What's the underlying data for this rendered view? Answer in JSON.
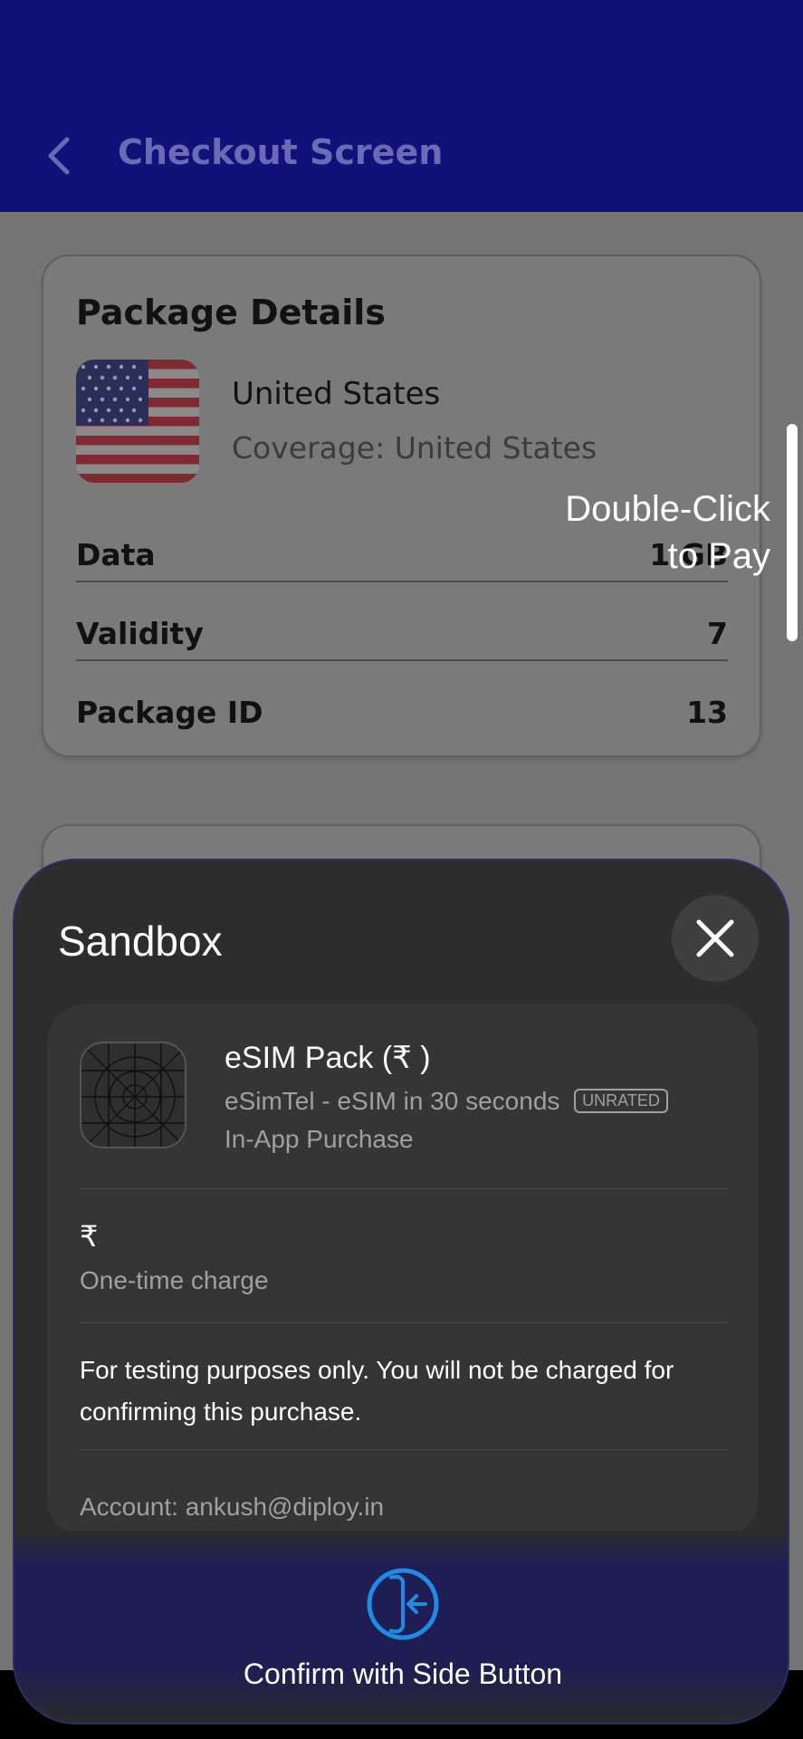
{
  "header": {
    "title": "Checkout Screen",
    "back_icon": "chevron-left-icon"
  },
  "package_details": {
    "title": "Package Details",
    "country": "United States",
    "coverage": "Coverage: United States",
    "flag_icon": "us-flag-icon",
    "rows": [
      {
        "label": "Data",
        "value": "1 GB"
      },
      {
        "label": "Validity",
        "value": "7"
      },
      {
        "label": "Package ID",
        "value": "13"
      }
    ]
  },
  "overlay_hint": {
    "line1": "Double-Click",
    "line2": "to Pay"
  },
  "sheet": {
    "title": "Sandbox",
    "close_icon": "close-icon",
    "product_name": "eSIM Pack (₹    )",
    "developer": "eSimTel - eSIM in 30 seconds",
    "rating_badge": "UNRATED",
    "type": "In-App Purchase",
    "price": "₹",
    "charge_type": "One-time charge",
    "note": "For testing purposes only. You will not be charged for confirming this purchase.",
    "account": "Account: ankush@diploy.in",
    "confirm_label": "Confirm with Side Button",
    "confirm_icon": "side-button-icon"
  },
  "colors": {
    "header": "#11117a",
    "accent": "#1e8ce6"
  }
}
